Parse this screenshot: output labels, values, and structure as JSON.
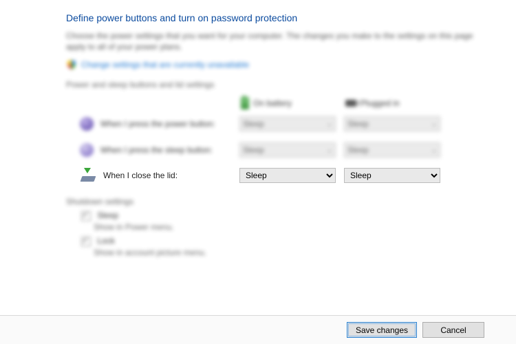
{
  "title": "Define power buttons and turn on password protection",
  "description": "Choose the power settings that you want for your computer. The changes you make to the settings on this page apply to all of your power plans.",
  "admin_link": "Change settings that are currently unavailable",
  "section_buttons": "Power and sleep buttons and lid settings",
  "columns": {
    "battery": "On battery",
    "plugged": "Plugged in"
  },
  "rows": {
    "power": {
      "label": "When I press the power button:",
      "battery": "Sleep",
      "plugged": "Sleep"
    },
    "sleep": {
      "label": "When I press the sleep button:",
      "battery": "Sleep",
      "plugged": "Sleep"
    },
    "lid": {
      "label": "When I close the lid:",
      "battery": "Sleep",
      "plugged": "Sleep"
    }
  },
  "shutdown_header": "Shutdown settings",
  "shutdown": {
    "sleep": {
      "label": "Sleep",
      "sub": "Show in Power menu."
    },
    "lock": {
      "label": "Lock",
      "sub": "Show in account picture menu."
    }
  },
  "buttons": {
    "save": "Save changes",
    "cancel": "Cancel"
  }
}
